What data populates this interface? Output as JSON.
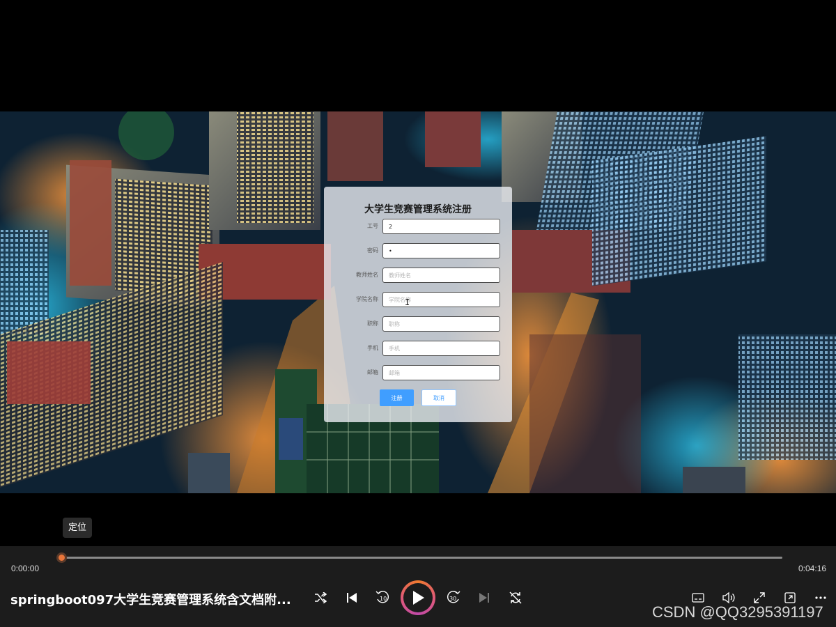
{
  "form": {
    "title": "大学生竞赛管理系统注册",
    "fields": [
      {
        "label": "工号",
        "value": "2",
        "placeholder": ""
      },
      {
        "label": "密码",
        "value": "•",
        "placeholder": ""
      },
      {
        "label": "教师姓名",
        "value": "",
        "placeholder": "教师姓名"
      },
      {
        "label": "学院名称",
        "value": "",
        "placeholder": "学院名称"
      },
      {
        "label": "职称",
        "value": "",
        "placeholder": "职称"
      },
      {
        "label": "手机",
        "value": "",
        "placeholder": "手机"
      },
      {
        "label": "邮箱",
        "value": "",
        "placeholder": "邮箱"
      }
    ],
    "register_label": "注册",
    "cancel_label": "取消"
  },
  "player": {
    "tooltip": "定位",
    "current_time": "0:00:00",
    "total_time": "0:04:16",
    "progress": 0,
    "title": "springboot097大学生竞赛管理系统含文档附...",
    "accent_color": "#e8753a",
    "buttons": [
      "shuffle-icon",
      "previous-icon",
      "rewind-10-icon",
      "play-icon",
      "forward-30-icon",
      "next-icon",
      "repeat-off-icon",
      "subtitles-icon",
      "volume-icon",
      "fullscreen-icon",
      "mini-player-icon",
      "more-icon"
    ]
  },
  "watermark": "CSDN @QQ3295391197"
}
